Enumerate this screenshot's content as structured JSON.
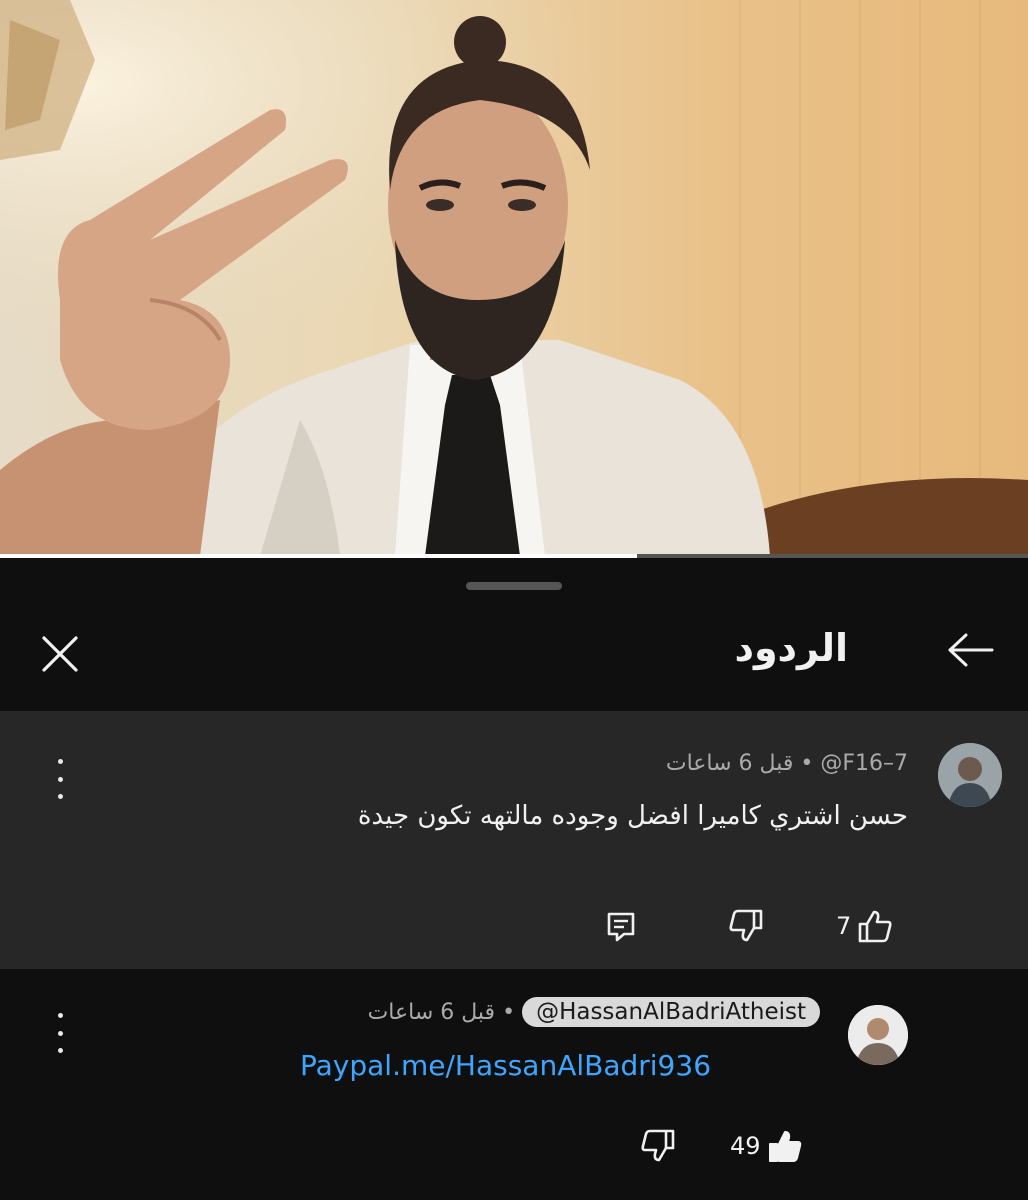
{
  "header": {
    "title": "الردود"
  },
  "video": {
    "progress": 0.62
  },
  "parent_comment": {
    "handle": "@F16–7",
    "separator": "•",
    "time": "قبل 6 ساعات",
    "text": "حسن اشتري كاميرا افضل وجوده مالتهه تكون جيدة",
    "likes": "7"
  },
  "reply": {
    "handle": "@HassanAlBadriAtheist",
    "separator": "•",
    "time": "قبل 6 ساعات",
    "text": "Paypal.me/HassanAlBadri936",
    "likes": "49"
  },
  "icons": {
    "back": "arrow-left-icon",
    "close": "close-icon",
    "more": "more-vertical-icon",
    "like": "thumbs-up-icon",
    "dislike": "thumbs-down-icon",
    "reply": "comment-reply-icon"
  },
  "colors": {
    "background": "#0f0f0f",
    "parent_background": "#272727",
    "link": "#3ea6ff",
    "meta": "#aaaaaa",
    "chip": "#d9d9d9"
  }
}
